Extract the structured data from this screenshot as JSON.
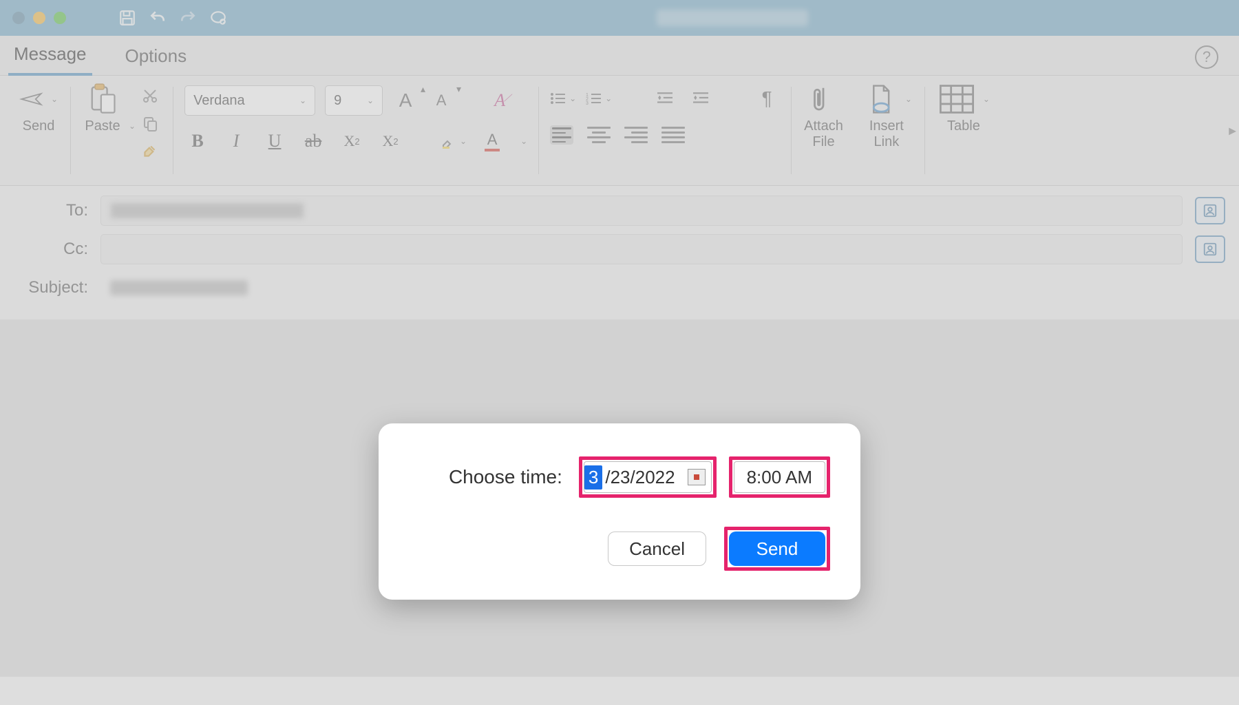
{
  "titlebar": {
    "icons": [
      "save-icon",
      "undo-icon",
      "redo-icon",
      "sync-icon"
    ]
  },
  "tabs": {
    "message": "Message",
    "options": "Options"
  },
  "ribbon": {
    "send": "Send",
    "paste": "Paste",
    "font_name": "Verdana",
    "font_size": "9",
    "attach_file": "Attach\nFile",
    "insert_link": "Insert\nLink",
    "table": "Table"
  },
  "fields": {
    "to_label": "To:",
    "cc_label": "Cc:",
    "subject_label": "Subject:"
  },
  "dialog": {
    "label": "Choose time:",
    "date_month": "3",
    "date_rest": "/23/2022",
    "time": "8:00 AM",
    "cancel": "Cancel",
    "send": "Send"
  }
}
